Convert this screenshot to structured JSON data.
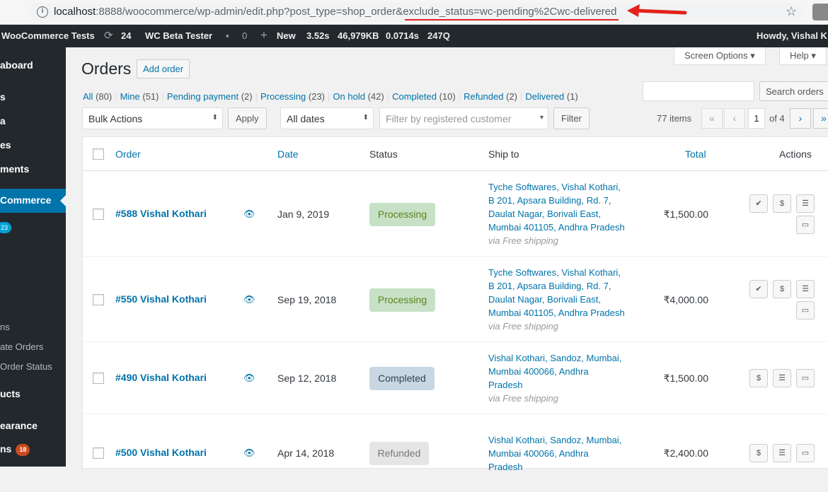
{
  "browser": {
    "url_host": "localhost",
    "url_rest": ":8888/woocommerce/wp-admin/edit.php?post_type=shop_order&",
    "url_highlight": "exclude_status=wc-pending%2Cwc-delivered"
  },
  "adminbar": {
    "site": "WooCommerce Tests",
    "updates": "24",
    "plugin": "WC Beta Tester",
    "comments": "0",
    "new": "New",
    "time": "3.52s",
    "memory": "46,979KB",
    "queries_time": "0.0714s",
    "queries": "247Q",
    "howdy": "Howdy, Vishal K"
  },
  "sidebar": {
    "dashboard": "aboard",
    "posts": "s",
    "media": "a",
    "pages": "es",
    "comments": "ments",
    "woocommerce": "Commerce",
    "orders_badge": "23",
    "sub1": "ns",
    "sub2": "ate Orders",
    "sub3": "Order Status",
    "products": "ucts",
    "appearance": "earance",
    "plugins": "ns",
    "plugins_badge": "18"
  },
  "screen_options": "Screen Options",
  "help": "Help",
  "page_title": "Orders",
  "add_order": "Add order",
  "status_links": [
    {
      "label": "All",
      "count": "(80)"
    },
    {
      "label": "Mine",
      "count": "(51)"
    },
    {
      "label": "Pending payment",
      "count": "(2)"
    },
    {
      "label": "Processing",
      "count": "(23)"
    },
    {
      "label": "On hold",
      "count": "(42)"
    },
    {
      "label": "Completed",
      "count": "(10)"
    },
    {
      "label": "Refunded",
      "count": "(2)"
    },
    {
      "label": "Delivered",
      "count": "(1)"
    }
  ],
  "search_button": "Search orders",
  "bulk_actions": "Bulk Actions",
  "apply": "Apply",
  "all_dates": "All dates",
  "customer_placeholder": "Filter by registered customer",
  "filter": "Filter",
  "items_count": "77 items",
  "page_current": "1",
  "page_of": "of 4",
  "columns": {
    "order": "Order",
    "date": "Date",
    "status": "Status",
    "ship_to": "Ship to",
    "total": "Total",
    "actions": "Actions"
  },
  "orders": [
    {
      "order": "#588 Vishal Kothari",
      "date": "Jan 9, 2019",
      "status": "Processing",
      "ship": [
        "Tyche Softwares, Vishal Kothari,",
        "B 201, Apsara Building, Rd. 7,",
        "Daulat Nagar, Borivali East,",
        "Mumbai 401105, Andhra Pradesh"
      ],
      "via": "via Free shipping",
      "total": "₹1,500.00"
    },
    {
      "order": "#550 Vishal Kothari",
      "date": "Sep 19, 2018",
      "status": "Processing",
      "ship": [
        "Tyche Softwares, Vishal Kothari,",
        "B 201, Apsara Building, Rd. 7,",
        "Daulat Nagar, Borivali East,",
        "Mumbai 401105, Andhra Pradesh"
      ],
      "via": "via Free shipping",
      "total": "₹4,000.00"
    },
    {
      "order": "#490 Vishal Kothari",
      "date": "Sep 12, 2018",
      "status": "Completed",
      "ship": [
        "Vishal Kothari, Sandoz, Mumbai,",
        "Mumbai 400066, Andhra",
        "Pradesh"
      ],
      "via": "via Free shipping",
      "total": "₹1,500.00"
    },
    {
      "order": "#500 Vishal Kothari",
      "date": "Apr 14, 2018",
      "status": "Refunded",
      "ship": [
        "Vishal Kothari, Sandoz, Mumbai,",
        "Mumbai 400066, Andhra",
        "Pradesh"
      ],
      "via": "",
      "total": "₹2,400.00"
    }
  ],
  "colors": {
    "accent": "#0073aa",
    "adminbar": "#23282d",
    "arrow": "#e2231a"
  }
}
